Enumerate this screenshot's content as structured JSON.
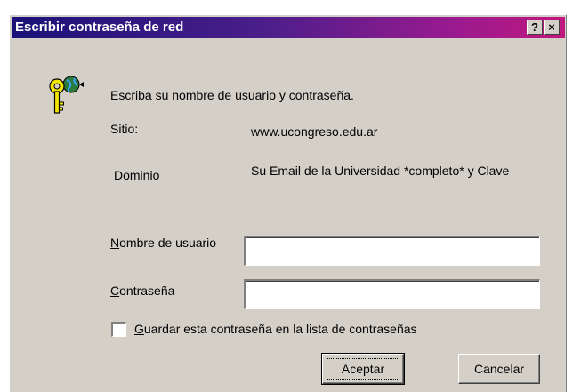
{
  "window": {
    "title": "Escribir contraseña de red",
    "help_label": "?",
    "close_label": "×",
    "title_gradient": [
      "#1a1278",
      "#c0187e"
    ]
  },
  "icons": {
    "key": "key-globe-icon"
  },
  "message": {
    "instructions": "Escriba su nombre de usuario y contraseña.",
    "site_label": "Sitio:",
    "site_value": "www.ucongreso.edu.ar",
    "domain_label": "Dominio",
    "domain_value": "Su Email de la Universidad *completo* y Clave"
  },
  "form": {
    "username": {
      "label_access": "N",
      "label_rest": "ombre de usuario",
      "value": ""
    },
    "password": {
      "label_access": "C",
      "label_rest": "ontraseña",
      "value": ""
    },
    "save_password": {
      "label_access": "G",
      "label_rest": "uardar esta contraseña en la lista de contraseñas",
      "checked": false
    }
  },
  "buttons": {
    "ok": "Aceptar",
    "cancel": "Cancelar"
  }
}
